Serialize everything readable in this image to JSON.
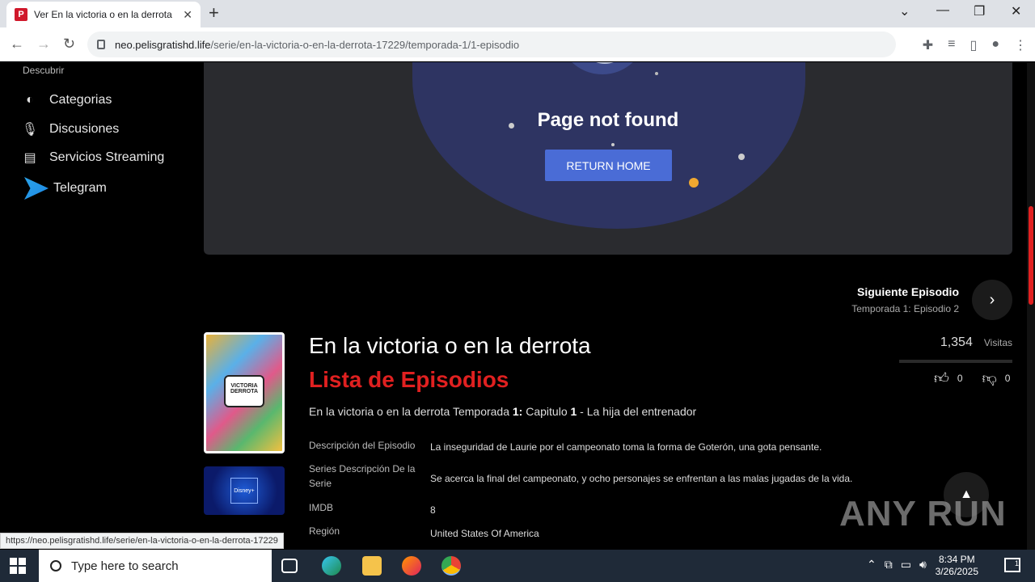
{
  "browser": {
    "tab_title": "Ver En la victoria o en la derrota",
    "tab_close": "✕",
    "new_tab": "+",
    "url_host": "neo.pelisgratishd.life",
    "url_path": "/serie/en-la-victoria-o-en-la-derrota-17229/temporada-1/1-episodio",
    "status_url": "https://neo.pelisgratishd.life/serie/en-la-victoria-o-en-la-derrota-17229"
  },
  "sidebar": {
    "section": "Descubrir",
    "items": [
      {
        "label": "Categorias",
        "icon": "half-circle-icon"
      },
      {
        "label": "Discusiones",
        "icon": "microphone-icon"
      },
      {
        "label": "Servicios Streaming",
        "icon": "tv-stack-icon"
      },
      {
        "label": "Telegram",
        "icon": "telegram-icon"
      }
    ]
  },
  "player": {
    "message": "Page not found",
    "button": "RETURN HOME"
  },
  "next_episode": {
    "title": "Siguiente Episodio",
    "subtitle": "Temporada 1: Episodio 2"
  },
  "poster": {
    "logo_text": "VICTORIA DERROTA",
    "network": "Disney+"
  },
  "show": {
    "title": "En la victoria o en la derrota",
    "subtitle": "Lista de Episodios",
    "line_prefix": "En la victoria o en la derrota Temporada ",
    "season": "1:",
    "line_mid": " Capitulo ",
    "episode": "1",
    "line_suffix": " - La hija del entrenador",
    "meta": [
      {
        "label": "Descripción del Episodio",
        "value": "La inseguridad de Laurie por el campeonato toma la forma de Goterón, una gota pensante."
      },
      {
        "label": "Series Descripción De la Serie",
        "value": "Se acerca la final del campeonato, y ocho personajes se enfrentan a las malas jugadas de la vida."
      },
      {
        "label": "IMDB",
        "value": "8"
      },
      {
        "label": "Región",
        "value": "United States Of America"
      }
    ],
    "views_count": "1,354",
    "views_label": "Visitas",
    "likes": "0",
    "dislikes": "0"
  },
  "watermark": "ANY RUN",
  "taskbar": {
    "search_placeholder": "Type here to search",
    "time": "8:34 PM",
    "date": "3/26/2025",
    "notifications": "1"
  }
}
